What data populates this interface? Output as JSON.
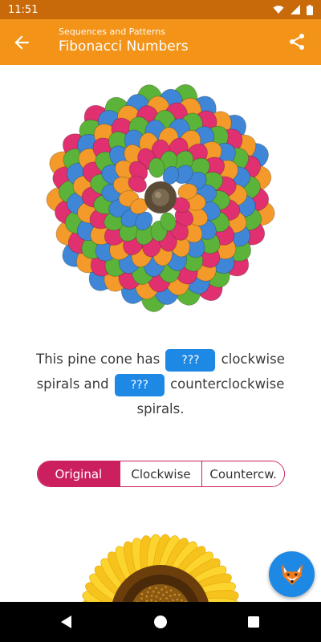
{
  "status_bar": {
    "time": "11:51",
    "icons": [
      "wifi-icon",
      "signal-icon",
      "battery-icon"
    ]
  },
  "app_bar": {
    "subtitle": "Sequences and Patterns",
    "title": "Fibonacci Numbers",
    "back_icon": "arrow-left-icon",
    "share_icon": "share-icon",
    "color": "#f39419"
  },
  "question": {
    "part1": "This pine cone has",
    "blank1": "???",
    "part2": "clockwise spirals and",
    "blank2": "???",
    "part3": "counterclockwise spirals.",
    "blank_color": "#1e88e5"
  },
  "view_toggle": {
    "options": [
      "Original",
      "Clockwise",
      "Countercw."
    ],
    "selected": "Original",
    "accent": "#cc1f60"
  },
  "images": {
    "pinecone": "colored-pine-cone",
    "sunflower": "sunflower"
  },
  "fab": {
    "icon": "fox-icon"
  },
  "nav": {
    "buttons": [
      "back-triangle-icon",
      "home-circle-icon",
      "recents-square-icon"
    ]
  }
}
